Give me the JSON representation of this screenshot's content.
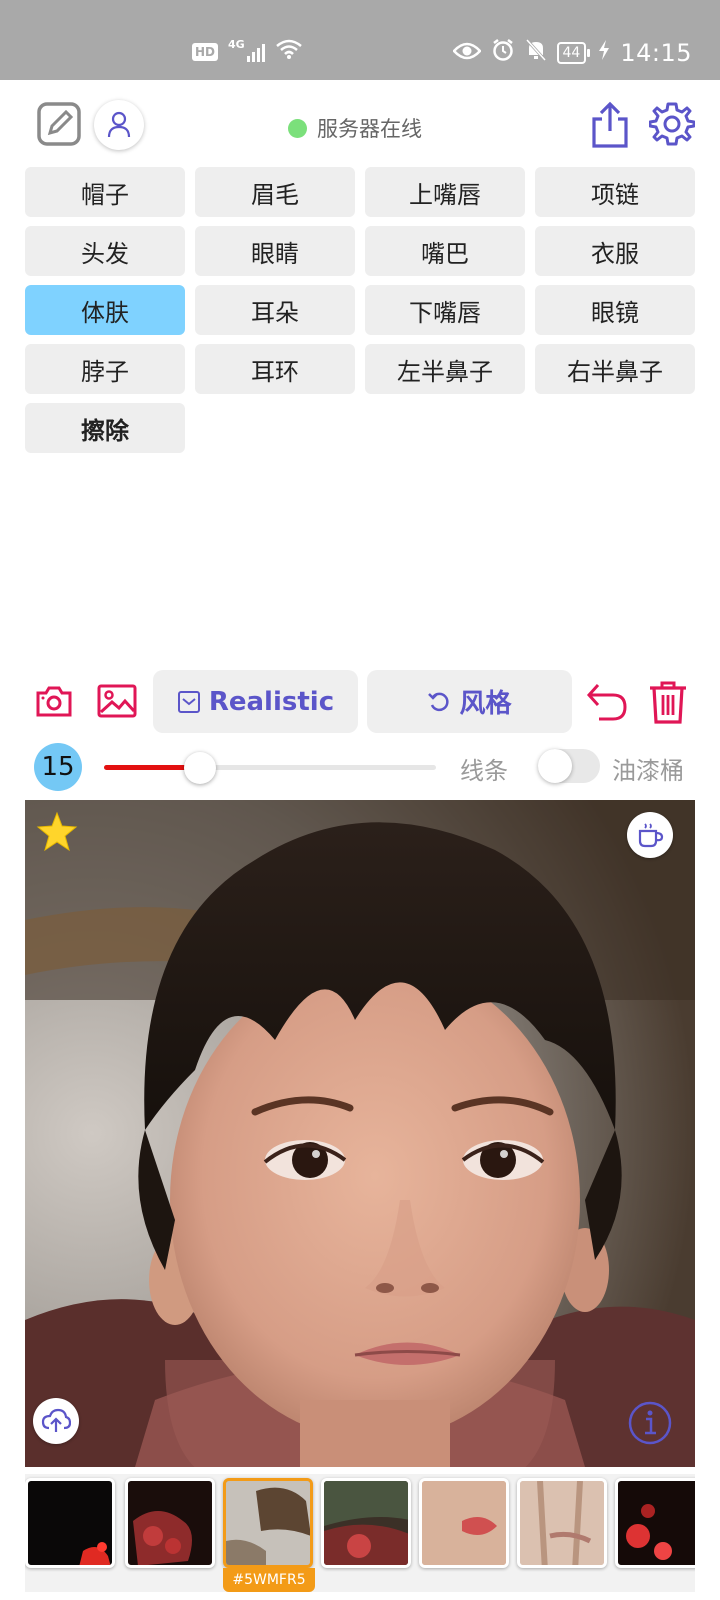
{
  "status_bar": {
    "hd": "HD",
    "network": "4G",
    "battery": "44",
    "time": "14:15"
  },
  "header": {
    "server_status": "服务器在线"
  },
  "parts": [
    {
      "label": "帽子",
      "active": false
    },
    {
      "label": "眉毛",
      "active": false
    },
    {
      "label": "上嘴唇",
      "active": false
    },
    {
      "label": "项链",
      "active": false
    },
    {
      "label": "头发",
      "active": false
    },
    {
      "label": "眼睛",
      "active": false
    },
    {
      "label": "嘴巴",
      "active": false
    },
    {
      "label": "衣服",
      "active": false
    },
    {
      "label": "体肤",
      "active": true
    },
    {
      "label": "耳朵",
      "active": false
    },
    {
      "label": "下嘴唇",
      "active": false
    },
    {
      "label": "眼镜",
      "active": false
    },
    {
      "label": "脖子",
      "active": false
    },
    {
      "label": "耳环",
      "active": false
    },
    {
      "label": "左半鼻子",
      "active": false
    },
    {
      "label": "右半鼻子",
      "active": false
    },
    {
      "label": "擦除",
      "active": false
    }
  ],
  "toolbar": {
    "realistic_label": "Realistic",
    "style_label": "风格"
  },
  "brush": {
    "size": "15",
    "slider_fraction": 0.29,
    "line_label": "线条",
    "bucket_label": "油漆桶",
    "bucket_enabled": false
  },
  "thumbnails": {
    "selected_caption": "#5WMFR5",
    "selected_index": 2
  },
  "colors": {
    "accent": "#5b55c9",
    "danger": "#e01656",
    "active_part": "#7fd2ff",
    "server_online": "#7be07b",
    "slider_fill": "#e31010",
    "selected_thumb": "#f39b17"
  }
}
